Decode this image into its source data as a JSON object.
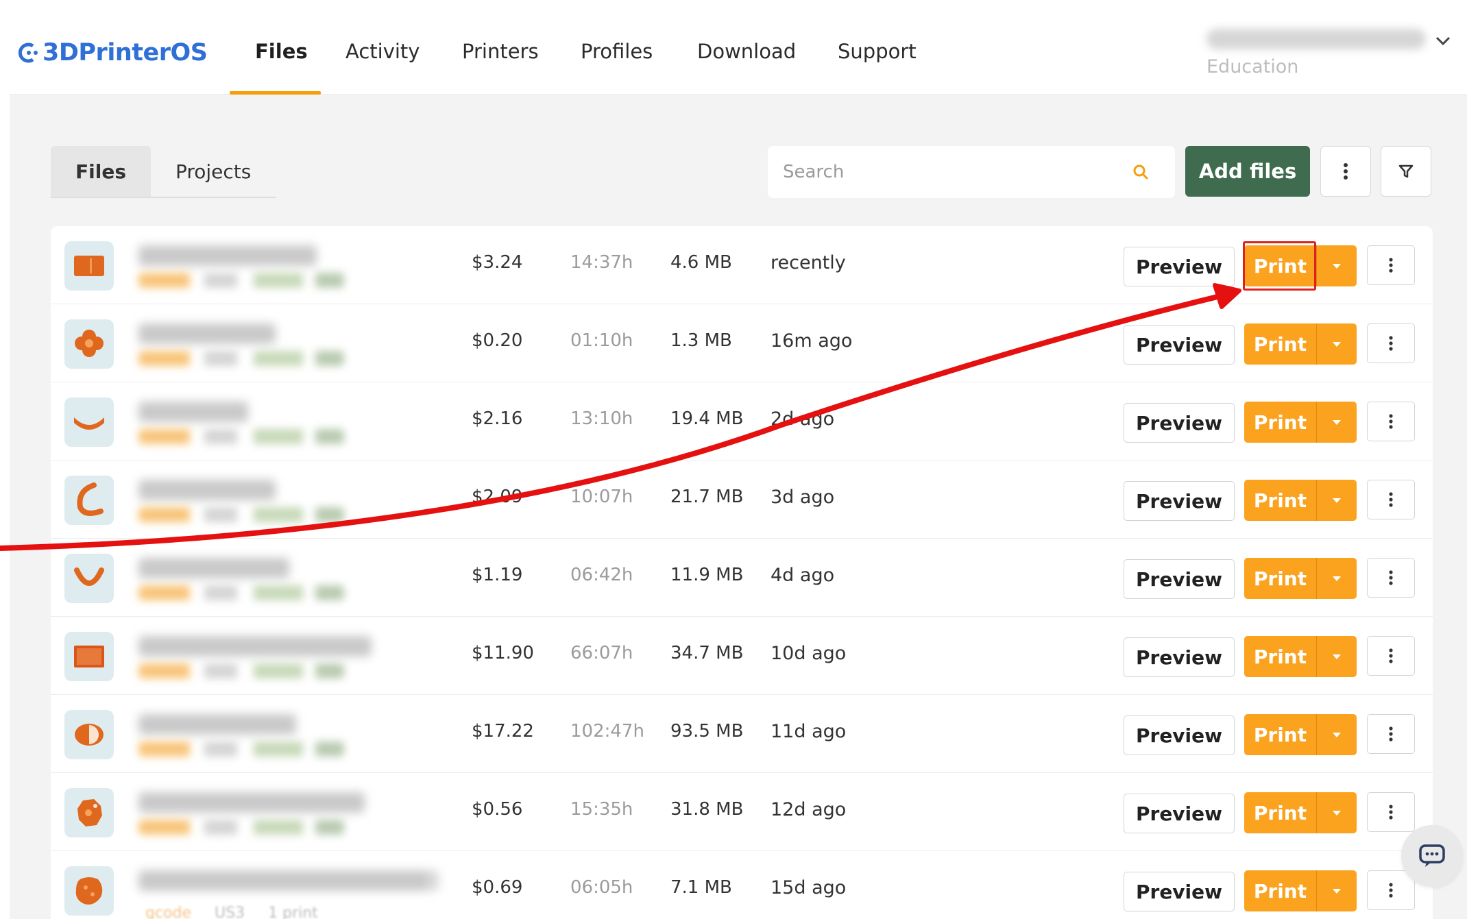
{
  "app": {
    "brand": "3DPrinterOS",
    "accent_color": "#fba21e",
    "primary_button_color": "#3f6b4e"
  },
  "nav": {
    "tabs": [
      {
        "label": "Files",
        "active": true
      },
      {
        "label": "Activity",
        "active": false
      },
      {
        "label": "Printers",
        "active": false
      },
      {
        "label": "Profiles",
        "active": false
      },
      {
        "label": "Download",
        "active": false
      },
      {
        "label": "Support",
        "active": false
      }
    ],
    "user_subtitle": "Education"
  },
  "subtabs": [
    {
      "label": "Files",
      "active": true
    },
    {
      "label": "Projects",
      "active": false
    }
  ],
  "toolbar": {
    "search_placeholder": "Search",
    "add_files_label": "Add files"
  },
  "files": [
    {
      "cost": "$3.24",
      "time": "14:37h",
      "size": "4.6 MB",
      "date": "recently",
      "icon": "rectangle-part-icon"
    },
    {
      "cost": "$0.20",
      "time": "01:10h",
      "size": "1.3 MB",
      "date": "16m ago",
      "icon": "flower-part-icon"
    },
    {
      "cost": "$2.16",
      "time": "13:10h",
      "size": "19.4 MB",
      "date": "2d ago",
      "icon": "curved-part-icon"
    },
    {
      "cost": "$2.09",
      "time": "10:07h",
      "size": "21.7 MB",
      "date": "3d ago",
      "icon": "hook-part-icon"
    },
    {
      "cost": "$1.19",
      "time": "06:42h",
      "size": "11.9 MB",
      "date": "4d ago",
      "icon": "arc-part-icon"
    },
    {
      "cost": "$11.90",
      "time": "66:07h",
      "size": "34.7 MB",
      "date": "10d ago",
      "icon": "panel-part-icon"
    },
    {
      "cost": "$17.22",
      "time": "102:47h",
      "size": "93.5 MB",
      "date": "11d ago",
      "icon": "disc-part-icon"
    },
    {
      "cost": "$0.56",
      "time": "15:35h",
      "size": "31.8 MB",
      "date": "12d ago",
      "icon": "gear-part-icon"
    },
    {
      "cost": "$0.69",
      "time": "06:05h",
      "size": "7.1 MB",
      "date": "15d ago",
      "icon": "blob-part-icon"
    }
  ],
  "row_actions": {
    "preview_label": "Preview",
    "print_label": "Print"
  },
  "last_row_meta": [
    "gcode",
    "US3",
    "1 print"
  ]
}
